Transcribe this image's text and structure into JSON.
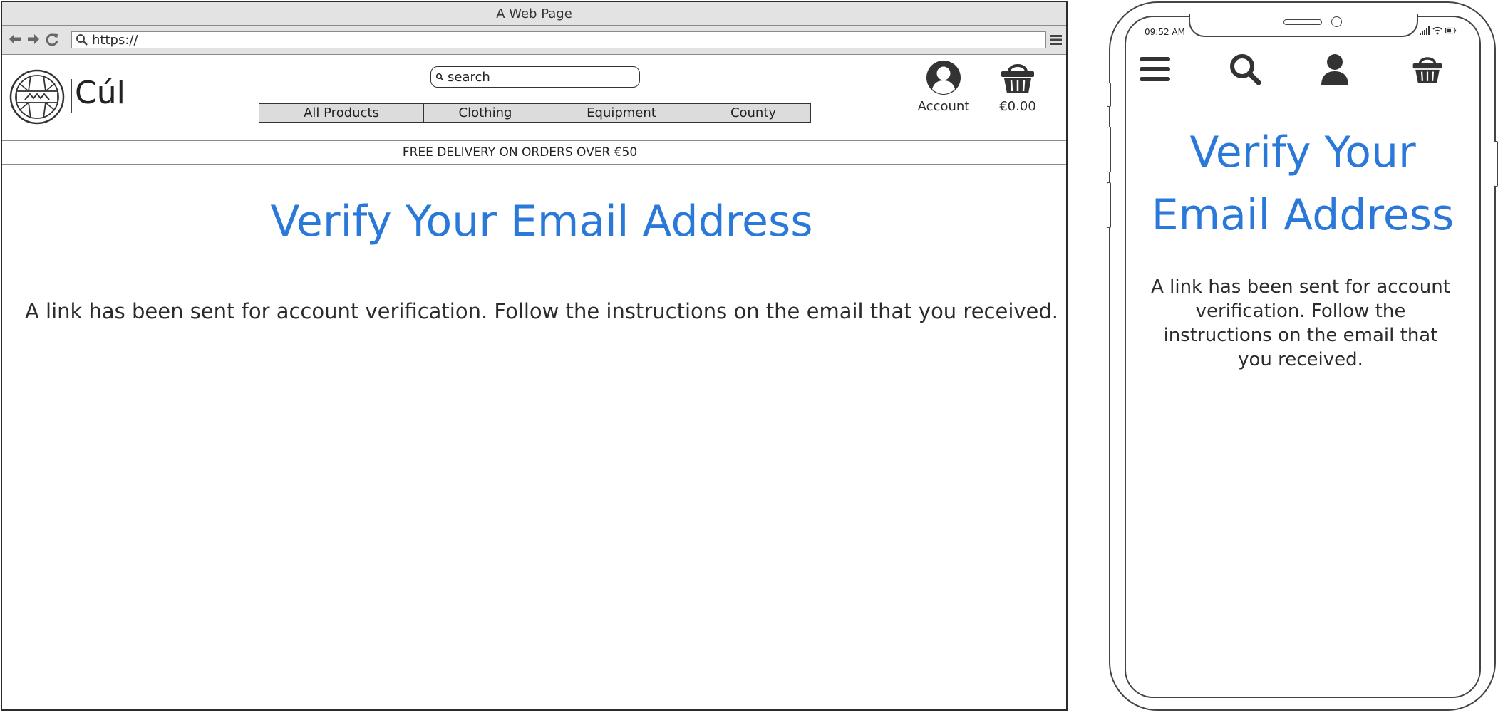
{
  "browser": {
    "window_title": "A Web Page",
    "url": "https://"
  },
  "site": {
    "brand": "Cúl",
    "search_placeholder": "search",
    "nav": [
      "All Products",
      "Clothing",
      "Equipment",
      "County"
    ],
    "account_label": "Account",
    "cart_total": "€0.00",
    "banner": "FREE DELIVERY ON ORDERS OVER €50"
  },
  "page": {
    "title": "Verify Your Email Address",
    "message": "A link has been sent for account verification. Follow the instructions on the email that you received."
  },
  "phone": {
    "time": "09:52 AM"
  },
  "colors": {
    "heading": "#2a78d8",
    "chrome": "#e3e3e3",
    "text": "#2b2b2b"
  },
  "icons": {
    "back": "arrow-left-icon",
    "forward": "arrow-right-icon",
    "reload": "reload-icon",
    "menu": "hamburger-icon",
    "search": "search-icon",
    "account": "user-icon",
    "cart": "basket-icon"
  }
}
